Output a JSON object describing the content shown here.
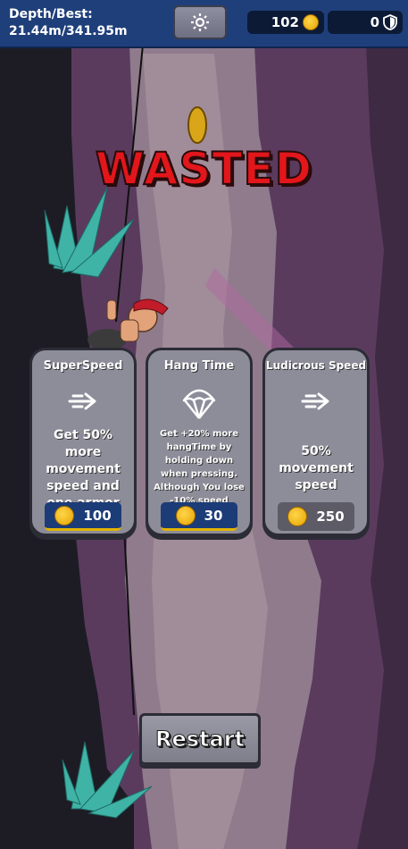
{
  "hud": {
    "depth_label": "Depth/Best:",
    "depth_value": "21.44m/341.95m",
    "coins": "102",
    "armor": "0"
  },
  "icons": {
    "settings": "gear-icon",
    "coin": "coin-icon",
    "shield": "shield-icon"
  },
  "banner": {
    "text": "WASTED",
    "color": "#e3161b"
  },
  "upgrades": [
    {
      "title": "SuperSpeed",
      "icon": "speed-arrows-icon",
      "description": "Get 50% more movement speed and one armor",
      "price": "100",
      "affordable": true
    },
    {
      "title": "Hang Time",
      "icon": "parachute-icon",
      "description": "Get +20% more hangTime by holding down when pressing. Although You lose -10% speed",
      "price": "30",
      "affordable": true
    },
    {
      "title": "Ludicrous Speed",
      "icon": "speed-arrows-icon",
      "description": "50% movement speed",
      "price": "250",
      "affordable": false
    }
  ],
  "restart_label": "Restart",
  "colors": {
    "hud_bar": "#1f3f7a",
    "card_bg": "#8d8c99",
    "price_blue": "#1c3c78",
    "price_gray": "#5c5b66"
  }
}
